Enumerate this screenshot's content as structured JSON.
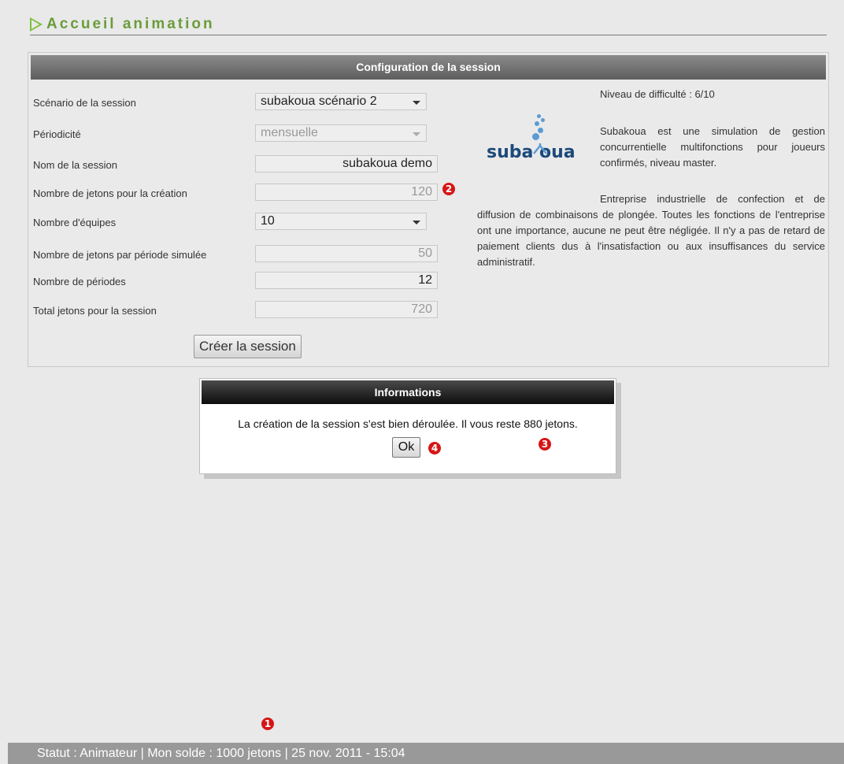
{
  "header": {
    "title": "Accueil animation"
  },
  "config": {
    "title": "Configuration de la session",
    "rows": [
      {
        "label": "Scénario de la session",
        "value": "subakoua scénario 2"
      },
      {
        "label": "Périodicité",
        "value": "mensuelle"
      },
      {
        "label": "Nom de la session",
        "value": "subakoua demo"
      },
      {
        "label": "Nombre de jetons pour la création",
        "value": "120"
      },
      {
        "label": "Nombre d'équipes",
        "value": "10"
      },
      {
        "label": "Nombre de jetons par période simulée",
        "value": "50"
      },
      {
        "label": "Nombre de périodes",
        "value": "12"
      },
      {
        "label": "Total jetons pour la session",
        "value": "720"
      }
    ],
    "create_button": "Créer la session"
  },
  "scenario_info": {
    "difficulty": "Niveau de difficulté : 6/10",
    "logo_text": "suba  oua",
    "short_description": "Subakoua est une simulation de gestion concurrentielle multifonctions pour joueurs confirmés, niveau master.",
    "long_description": "Entreprise industrielle de confection et de diffusion de combinaisons de plongée. Toutes les fonctions de l'entreprise ont une importance, aucune ne peut être négligée. Il n'y a pas de retard de paiement clients dus à l'insatisfaction ou aux insuffisances du service administratif."
  },
  "dialog": {
    "title": "Informations",
    "message": "La création de la session s'est bien déroulée. Il vous reste 880 jetons.",
    "ok": "Ok"
  },
  "status_bar": {
    "text": "Statut : Animateur | Mon solde : 1000 jetons | 25 nov. 2011 - 15:04"
  },
  "markers": {
    "m1": "1",
    "m2": "2",
    "m3": "3",
    "m4": "4"
  },
  "colors": {
    "accent": "#6a9c3a",
    "marker": "#d61515",
    "panel_header": "#707070",
    "dialog_header": "#1a1a1a"
  }
}
